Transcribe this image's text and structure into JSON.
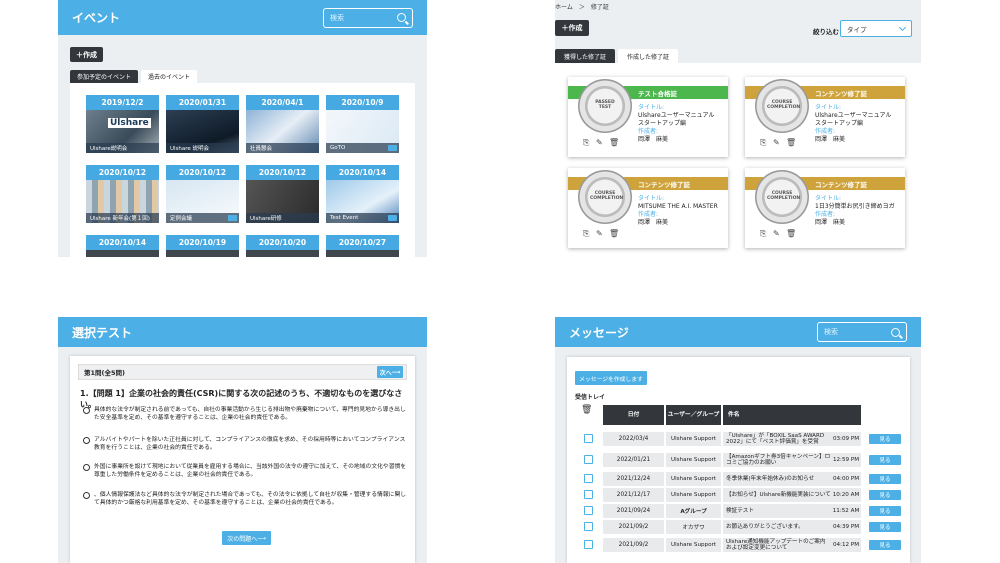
{
  "events": {
    "title": "イベント",
    "search_placeholder": "検索",
    "create_label": "＋作成",
    "tabs": [
      "参加予定のイベント",
      "過去のイベント"
    ],
    "cards": [
      {
        "date": "2019/12/2",
        "label": "Ulshare説明会",
        "logo": "Ulshare"
      },
      {
        "date": "2020/01/31",
        "label": "Ulshare 説明会",
        "logo": ""
      },
      {
        "date": "2020/04/1",
        "label": "社員懇会",
        "logo": ""
      },
      {
        "date": "2020/10/9",
        "label": "GoTO",
        "logo": ""
      },
      {
        "date": "2020/10/12",
        "label": "Ulshare 新年会(第１回)",
        "logo": ""
      },
      {
        "date": "2020/10/12",
        "label": "定例会議",
        "logo": ""
      },
      {
        "date": "2020/10/12",
        "label": "Ulshare研修",
        "logo": ""
      },
      {
        "date": "2020/10/14",
        "label": "Test Event",
        "logo": ""
      },
      {
        "date": "2020/10/14",
        "label": "",
        "logo": ""
      },
      {
        "date": "2020/10/19",
        "label": "",
        "logo": ""
      },
      {
        "date": "2020/10/20",
        "label": "",
        "logo": ""
      },
      {
        "date": "2020/10/27",
        "label": "",
        "logo": ""
      }
    ]
  },
  "certs": {
    "breadcrumb": "ホーム　＞　修了証",
    "create_label": "＋作成",
    "filter_label": "絞り込む",
    "filter_value": "タイプ",
    "tabs": [
      "獲得した修了証",
      "作成した修了証"
    ],
    "title_key": "タイトル:",
    "author_key": "作成者:",
    "cards": [
      {
        "type": "テスト合格証",
        "color": "green",
        "seal": "PASSED TEST",
        "title": "Ulshareユーザーマニュアル　スタートアップ編",
        "author": "岡澤　麻美"
      },
      {
        "type": "コンテンツ修了証",
        "color": "gold",
        "seal": "COURSE COMPLETION",
        "title": "Ulshareユーザーマニュアル　スタートアップ編",
        "author": "岡澤　麻美"
      },
      {
        "type": "コンテンツ修了証",
        "color": "gold",
        "seal": "COURSE COMPLETION",
        "title": "MITSUME THE A.I. MASTER",
        "author": "岡澤　麻美"
      },
      {
        "type": "コンテンツ修了証",
        "color": "gold",
        "seal": "COURSE COMPLETION",
        "title": "1日3分簡単お尻引き締めヨガ",
        "author": "岡澤　麻美"
      }
    ]
  },
  "test": {
    "title": "選択テスト",
    "header": "第1問(全5問)",
    "next_label": "次へ",
    "question": "1.【問題 1】企業の社会的責任(CSR)に関する次の記述のうち、不適切なものを選びなさい。",
    "options": [
      "具体的な法令が制定される前であっても、自社の事業活動から生じる排出物や廃棄物について、専門的見地から導き出した安全基準を定め、その基準を遵守することは、企業の社会的責任である。",
      "アルバイトやパートを除いた正社員に対して、コンプライアンスの徹底を求め、その採用時等においてコンプライアンス教育を行うことは、企業の社会的責任である。",
      "外国に事業所を設けて現地において従業員を雇用する場合に、当該外国の法令の遵守に加えて、その地域の文化や習慣を尊重した労働条件を定めることは、企業の社会的責任である。",
      "、個人情報保護法など具体的な法令が制定された場合であっても、その法令に依拠して自社が収集・管理する情報に関して具体的かつ厳格な利用基準を定め、その基準を遵守することは、企業の社会的責任である。"
    ],
    "next_question_label": "次の問題へ"
  },
  "messages": {
    "title": "メッセージ",
    "search_placeholder": "検索",
    "compose_label": "メッセージを作成します",
    "inbox_label": "受信トレイ",
    "headers": {
      "date": "日付",
      "from": "ユーザー／グループ",
      "subject": "件名"
    },
    "view_label": "見る",
    "rows": [
      {
        "date": "2022/03/4",
        "from": "Ulshare Support",
        "subject": "「Ulshare」が「BOXIL SaaS AWARD 2022」にて「ベスト評価賞」を受賞",
        "time": "03:09 PM"
      },
      {
        "date": "2022/01/21",
        "from": "Ulshare Support",
        "subject": "【Amazonギフト券3倍キャンペーン】ロコミご協力のお願い",
        "time": "12:59 PM"
      },
      {
        "date": "2021/12/24",
        "from": "Ulshare Support",
        "subject": "冬季休業(年末年始休み)のお知らせ",
        "time": "04:00 PM"
      },
      {
        "date": "2021/12/17",
        "from": "Ulshare Support",
        "subject": "【お知らせ】Ulshare新機能実装について",
        "time": "10:20 AM"
      },
      {
        "date": "2021/09/24",
        "from": "Aグループ",
        "subject": "検証テスト",
        "time": "11:52 AM"
      },
      {
        "date": "2021/09/2",
        "from": "オカザワ",
        "subject": "お節込ありがとうございます。",
        "time": "04:39 PM"
      },
      {
        "date": "2021/09/2",
        "from": "Ulshare Support",
        "subject": "Ulshare通知機能アップデートのご案内　および設定変更について",
        "time": "04:12 PM"
      }
    ]
  }
}
